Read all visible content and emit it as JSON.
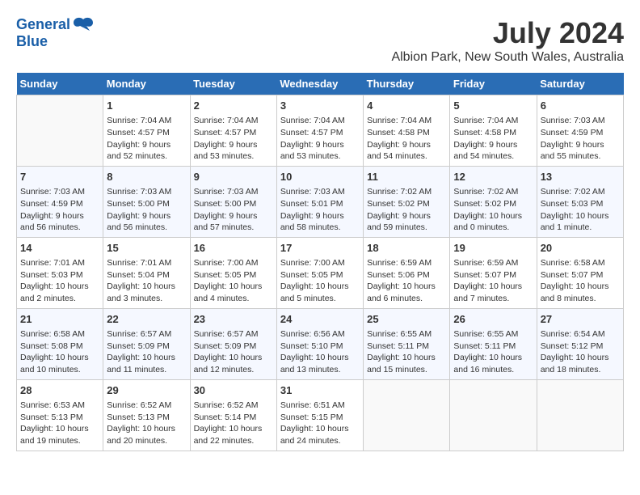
{
  "logo": {
    "line1": "General",
    "line2": "Blue"
  },
  "title": "July 2024",
  "location": "Albion Park, New South Wales, Australia",
  "weekdays": [
    "Sunday",
    "Monday",
    "Tuesday",
    "Wednesday",
    "Thursday",
    "Friday",
    "Saturday"
  ],
  "weeks": [
    [
      {
        "day": "",
        "empty": true
      },
      {
        "day": "1",
        "sunrise": "7:04 AM",
        "sunset": "4:57 PM",
        "daylight": "9 hours and 52 minutes."
      },
      {
        "day": "2",
        "sunrise": "7:04 AM",
        "sunset": "4:57 PM",
        "daylight": "9 hours and 53 minutes."
      },
      {
        "day": "3",
        "sunrise": "7:04 AM",
        "sunset": "4:57 PM",
        "daylight": "9 hours and 53 minutes."
      },
      {
        "day": "4",
        "sunrise": "7:04 AM",
        "sunset": "4:58 PM",
        "daylight": "9 hours and 54 minutes."
      },
      {
        "day": "5",
        "sunrise": "7:04 AM",
        "sunset": "4:58 PM",
        "daylight": "9 hours and 54 minutes."
      },
      {
        "day": "6",
        "sunrise": "7:03 AM",
        "sunset": "4:59 PM",
        "daylight": "9 hours and 55 minutes."
      }
    ],
    [
      {
        "day": "7",
        "sunrise": "7:03 AM",
        "sunset": "4:59 PM",
        "daylight": "9 hours and 56 minutes."
      },
      {
        "day": "8",
        "sunrise": "7:03 AM",
        "sunset": "5:00 PM",
        "daylight": "9 hours and 56 minutes."
      },
      {
        "day": "9",
        "sunrise": "7:03 AM",
        "sunset": "5:00 PM",
        "daylight": "9 hours and 57 minutes."
      },
      {
        "day": "10",
        "sunrise": "7:03 AM",
        "sunset": "5:01 PM",
        "daylight": "9 hours and 58 minutes."
      },
      {
        "day": "11",
        "sunrise": "7:02 AM",
        "sunset": "5:02 PM",
        "daylight": "9 hours and 59 minutes."
      },
      {
        "day": "12",
        "sunrise": "7:02 AM",
        "sunset": "5:02 PM",
        "daylight": "10 hours and 0 minutes."
      },
      {
        "day": "13",
        "sunrise": "7:02 AM",
        "sunset": "5:03 PM",
        "daylight": "10 hours and 1 minute."
      }
    ],
    [
      {
        "day": "14",
        "sunrise": "7:01 AM",
        "sunset": "5:03 PM",
        "daylight": "10 hours and 2 minutes."
      },
      {
        "day": "15",
        "sunrise": "7:01 AM",
        "sunset": "5:04 PM",
        "daylight": "10 hours and 3 minutes."
      },
      {
        "day": "16",
        "sunrise": "7:00 AM",
        "sunset": "5:05 PM",
        "daylight": "10 hours and 4 minutes."
      },
      {
        "day": "17",
        "sunrise": "7:00 AM",
        "sunset": "5:05 PM",
        "daylight": "10 hours and 5 minutes."
      },
      {
        "day": "18",
        "sunrise": "6:59 AM",
        "sunset": "5:06 PM",
        "daylight": "10 hours and 6 minutes."
      },
      {
        "day": "19",
        "sunrise": "6:59 AM",
        "sunset": "5:07 PM",
        "daylight": "10 hours and 7 minutes."
      },
      {
        "day": "20",
        "sunrise": "6:58 AM",
        "sunset": "5:07 PM",
        "daylight": "10 hours and 8 minutes."
      }
    ],
    [
      {
        "day": "21",
        "sunrise": "6:58 AM",
        "sunset": "5:08 PM",
        "daylight": "10 hours and 10 minutes."
      },
      {
        "day": "22",
        "sunrise": "6:57 AM",
        "sunset": "5:09 PM",
        "daylight": "10 hours and 11 minutes."
      },
      {
        "day": "23",
        "sunrise": "6:57 AM",
        "sunset": "5:09 PM",
        "daylight": "10 hours and 12 minutes."
      },
      {
        "day": "24",
        "sunrise": "6:56 AM",
        "sunset": "5:10 PM",
        "daylight": "10 hours and 13 minutes."
      },
      {
        "day": "25",
        "sunrise": "6:55 AM",
        "sunset": "5:11 PM",
        "daylight": "10 hours and 15 minutes."
      },
      {
        "day": "26",
        "sunrise": "6:55 AM",
        "sunset": "5:11 PM",
        "daylight": "10 hours and 16 minutes."
      },
      {
        "day": "27",
        "sunrise": "6:54 AM",
        "sunset": "5:12 PM",
        "daylight": "10 hours and 18 minutes."
      }
    ],
    [
      {
        "day": "28",
        "sunrise": "6:53 AM",
        "sunset": "5:13 PM",
        "daylight": "10 hours and 19 minutes."
      },
      {
        "day": "29",
        "sunrise": "6:52 AM",
        "sunset": "5:13 PM",
        "daylight": "10 hours and 20 minutes."
      },
      {
        "day": "30",
        "sunrise": "6:52 AM",
        "sunset": "5:14 PM",
        "daylight": "10 hours and 22 minutes."
      },
      {
        "day": "31",
        "sunrise": "6:51 AM",
        "sunset": "5:15 PM",
        "daylight": "10 hours and 24 minutes."
      },
      {
        "day": "",
        "empty": true
      },
      {
        "day": "",
        "empty": true
      },
      {
        "day": "",
        "empty": true
      }
    ]
  ],
  "labels": {
    "sunrise": "Sunrise:",
    "sunset": "Sunset:",
    "daylight": "Daylight:"
  }
}
